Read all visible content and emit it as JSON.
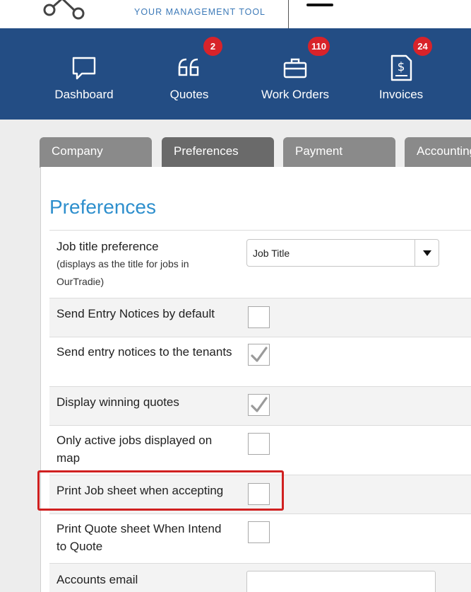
{
  "header": {
    "tagline": "YOUR MANAGEMENT TOOL"
  },
  "nav": {
    "items": [
      {
        "label": "Dashboard",
        "icon": "chat-bubble-icon",
        "badge": ""
      },
      {
        "label": "Quotes",
        "icon": "quote-marks-icon",
        "badge": "2"
      },
      {
        "label": "Work Orders",
        "icon": "briefcase-icon",
        "badge": "110"
      },
      {
        "label": "Invoices",
        "icon": "invoice-dollar-icon",
        "badge": "24"
      }
    ]
  },
  "tabs": [
    {
      "label": "Company",
      "active": false
    },
    {
      "label": "Preferences",
      "active": true
    },
    {
      "label": "Payment",
      "active": false
    },
    {
      "label": "Accounting",
      "active": false
    }
  ],
  "page": {
    "title": "Preferences"
  },
  "preferences": {
    "job_title": {
      "label": "Job title preference",
      "sublabel": "(displays as the title for jobs in OurTradie)",
      "value": "Job Title"
    },
    "send_entry_notices_default": {
      "label": "Send Entry Notices by default",
      "checked": false
    },
    "send_entry_notices_tenants": {
      "label": "Send entry notices to the tenants",
      "checked": true
    },
    "display_winning_quotes": {
      "label": "Display winning quotes",
      "checked": true
    },
    "only_active_jobs_map": {
      "label": "Only active jobs displayed on map",
      "checked": false
    },
    "print_job_sheet": {
      "label": "Print Job sheet when accepting",
      "checked": false
    },
    "print_quote_sheet": {
      "label": "Print Quote sheet When Intend to Quote",
      "checked": false
    },
    "accounts_email": {
      "label": "Accounts email",
      "value": ""
    }
  },
  "colors": {
    "nav_bg": "#234d84",
    "badge": "#d8232a",
    "title": "#2e8fcd",
    "highlight": "#d02020"
  }
}
